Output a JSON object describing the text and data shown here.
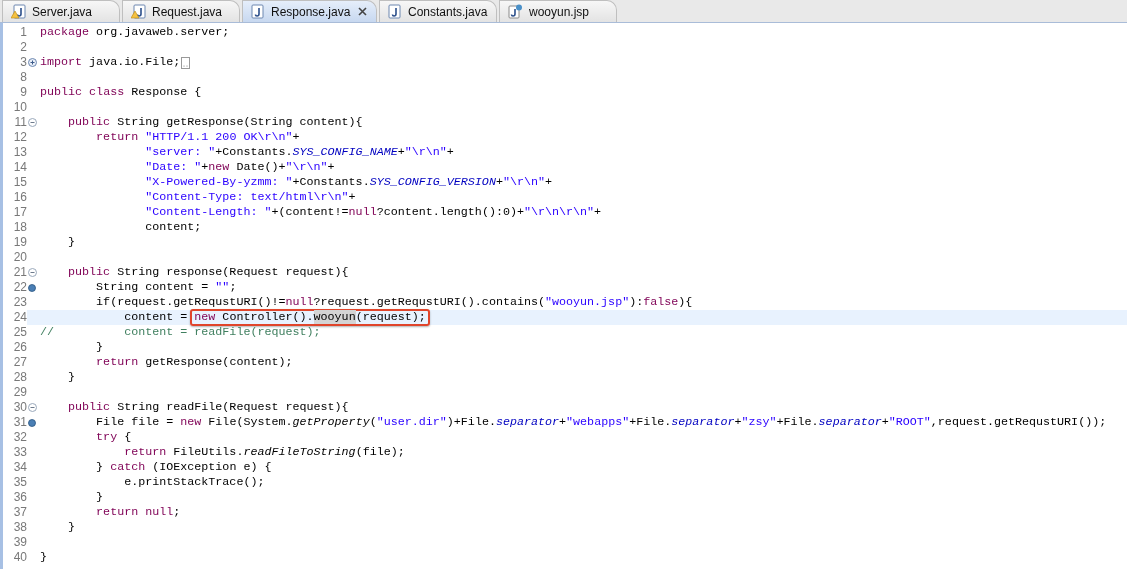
{
  "tabs": [
    {
      "label": "Server.java",
      "kind": "java-warning",
      "selected": false,
      "closable": false
    },
    {
      "label": "Request.java",
      "kind": "java-warning",
      "selected": false,
      "closable": false
    },
    {
      "label": "Response.java",
      "kind": "java",
      "selected": true,
      "closable": true
    },
    {
      "label": "Constants.java",
      "kind": "java",
      "selected": false,
      "closable": false
    },
    {
      "label": "wooyun.jsp",
      "kind": "jsp",
      "selected": false,
      "closable": false
    }
  ],
  "lines": [
    {
      "number": "1",
      "kind": "plain",
      "tokens": [
        {
          "kind": "keyword",
          "text": "package"
        },
        {
          "kind": "plain",
          "text": " org.javaweb.server;"
        }
      ]
    },
    {
      "number": "2",
      "kind": "plain"
    },
    {
      "number": "3",
      "kind": "expand",
      "folded": true,
      "tokens": [
        {
          "kind": "keyword",
          "text": "import"
        },
        {
          "kind": "plain",
          "text": " java.io.File;"
        }
      ]
    },
    {
      "number": "8",
      "kind": "plain"
    },
    {
      "number": "9",
      "kind": "plain",
      "tokens": [
        {
          "kind": "keyword",
          "text": "public "
        },
        {
          "kind": "keyword",
          "text": "class"
        },
        {
          "kind": "plain",
          "text": " Response {"
        }
      ]
    },
    {
      "number": "10",
      "kind": "plain"
    },
    {
      "number": "11",
      "kind": "collapse",
      "tokens": [
        {
          "kind": "keyword",
          "text": "    public"
        },
        {
          "kind": "plain",
          "text": " String getResponse(String content){"
        }
      ]
    },
    {
      "number": "12",
      "kind": "plain",
      "tokens": [
        {
          "kind": "keyword",
          "text": "        return"
        },
        {
          "kind": "string",
          "text": " \"HTTP/1.1 200 OK\\r\\n\""
        },
        {
          "kind": "plain",
          "text": "+"
        }
      ]
    },
    {
      "number": "13",
      "kind": "plain",
      "tokens": [
        {
          "kind": "string",
          "text": "               \"server: \""
        },
        {
          "kind": "plain",
          "text": "+Constants."
        },
        {
          "kind": "field",
          "text": "SYS_CONFIG_NAME"
        },
        {
          "kind": "plain",
          "text": "+"
        },
        {
          "kind": "string",
          "text": "\"\\r\\n\""
        },
        {
          "kind": "plain",
          "text": "+"
        }
      ]
    },
    {
      "number": "14",
      "kind": "plain",
      "tokens": [
        {
          "kind": "string",
          "text": "               \"Date: \""
        },
        {
          "kind": "plain",
          "text": "+"
        },
        {
          "kind": "keyword",
          "text": "new"
        },
        {
          "kind": "plain",
          "text": " Date()+"
        },
        {
          "kind": "string",
          "text": "\"\\r\\n\""
        },
        {
          "kind": "plain",
          "text": "+"
        }
      ]
    },
    {
      "number": "15",
      "kind": "plain",
      "tokens": [
        {
          "kind": "string",
          "text": "               \"X-Powered-By-yzmm: \""
        },
        {
          "kind": "plain",
          "text": "+Constants."
        },
        {
          "kind": "field",
          "text": "SYS_CONFIG_VERSION"
        },
        {
          "kind": "plain",
          "text": "+"
        },
        {
          "kind": "string",
          "text": "\"\\r\\n\""
        },
        {
          "kind": "plain",
          "text": "+"
        }
      ]
    },
    {
      "number": "16",
      "kind": "plain",
      "tokens": [
        {
          "kind": "string",
          "text": "               \"Content-Type: text/html\\r\\n\""
        },
        {
          "kind": "plain",
          "text": "+"
        }
      ]
    },
    {
      "number": "17",
      "kind": "plain",
      "tokens": [
        {
          "kind": "string",
          "text": "               \"Content-Length: \""
        },
        {
          "kind": "plain",
          "text": "+(content!="
        },
        {
          "kind": "keyword",
          "text": "null"
        },
        {
          "kind": "plain",
          "text": "?content.length():0)+"
        },
        {
          "kind": "string",
          "text": "\"\\r\\n\\r\\n\""
        },
        {
          "kind": "plain",
          "text": "+"
        }
      ]
    },
    {
      "number": "18",
      "kind": "plain",
      "tokens": [
        {
          "kind": "plain",
          "text": "               content;"
        }
      ]
    },
    {
      "number": "19",
      "kind": "plain",
      "tokens": [
        {
          "kind": "plain",
          "text": "    }"
        }
      ]
    },
    {
      "number": "20",
      "kind": "plain"
    },
    {
      "number": "21",
      "kind": "collapse",
      "tokens": [
        {
          "kind": "keyword",
          "text": "    public"
        },
        {
          "kind": "plain",
          "text": " String response(Request request){"
        }
      ]
    },
    {
      "number": "22",
      "kind": "override",
      "tokens": [
        {
          "kind": "plain",
          "text": "        String content = "
        },
        {
          "kind": "string",
          "text": "\"\""
        },
        {
          "kind": "plain",
          "text": ";"
        }
      ]
    },
    {
      "number": "23",
      "kind": "plain",
      "tokens": [
        {
          "kind": "plain",
          "text": "        if(request.getRequstURI()!="
        },
        {
          "kind": "keyword",
          "text": "null"
        },
        {
          "kind": "plain",
          "text": "?request.getRequstURI().contains("
        },
        {
          "kind": "string",
          "text": "\"wooyun.jsp\""
        },
        {
          "kind": "plain",
          "text": "):"
        },
        {
          "kind": "keyword",
          "text": "false"
        },
        {
          "kind": "plain",
          "text": "){"
        }
      ]
    },
    {
      "number": "24",
      "kind": "plain",
      "current": true,
      "tokens": [
        {
          "kind": "plain",
          "text": "            content = "
        },
        {
          "kind": "callout",
          "children": [
            {
              "kind": "keyword",
              "text": "new"
            },
            {
              "kind": "plain",
              "text": " Controller()."
            },
            {
              "kind": "occurrence",
              "text": "wooyun"
            },
            {
              "kind": "plain",
              "text": "(request);"
            }
          ]
        }
      ]
    },
    {
      "number": "25",
      "kind": "plain",
      "tokens": [
        {
          "kind": "comment",
          "text": "//          content = readFile(request);"
        }
      ]
    },
    {
      "number": "26",
      "kind": "plain",
      "tokens": [
        {
          "kind": "plain",
          "text": "        }"
        }
      ]
    },
    {
      "number": "27",
      "kind": "plain",
      "tokens": [
        {
          "kind": "keyword",
          "text": "        return"
        },
        {
          "kind": "plain",
          "text": " getResponse(content);"
        }
      ]
    },
    {
      "number": "28",
      "kind": "plain",
      "tokens": [
        {
          "kind": "plain",
          "text": "    }"
        }
      ]
    },
    {
      "number": "29",
      "kind": "plain"
    },
    {
      "number": "30",
      "kind": "collapse",
      "tokens": [
        {
          "kind": "keyword",
          "text": "    public"
        },
        {
          "kind": "plain",
          "text": " String readFile(Request request){"
        }
      ]
    },
    {
      "number": "31",
      "kind": "override",
      "tokens": [
        {
          "kind": "plain",
          "text": "        File file = "
        },
        {
          "kind": "keyword",
          "text": "new"
        },
        {
          "kind": "plain",
          "text": " File(System."
        },
        {
          "kind": "static-method",
          "text": "getProperty"
        },
        {
          "kind": "plain",
          "text": "("
        },
        {
          "kind": "string",
          "text": "\"user.dir\""
        },
        {
          "kind": "plain",
          "text": ")+File."
        },
        {
          "kind": "field",
          "text": "separator"
        },
        {
          "kind": "plain",
          "text": "+"
        },
        {
          "kind": "string",
          "text": "\"webapps\""
        },
        {
          "kind": "plain",
          "text": "+File."
        },
        {
          "kind": "field",
          "text": "separator"
        },
        {
          "kind": "plain",
          "text": "+"
        },
        {
          "kind": "string",
          "text": "\"zsy\""
        },
        {
          "kind": "plain",
          "text": "+File."
        },
        {
          "kind": "field",
          "text": "separator"
        },
        {
          "kind": "plain",
          "text": "+"
        },
        {
          "kind": "string",
          "text": "\"ROOT\""
        },
        {
          "kind": "plain",
          "text": ",request.getRequstURI());"
        }
      ]
    },
    {
      "number": "32",
      "kind": "plain",
      "tokens": [
        {
          "kind": "keyword",
          "text": "        try"
        },
        {
          "kind": "plain",
          "text": " {"
        }
      ]
    },
    {
      "number": "33",
      "kind": "plain",
      "tokens": [
        {
          "kind": "keyword",
          "text": "            return"
        },
        {
          "kind": "plain",
          "text": " FileUtils."
        },
        {
          "kind": "static-method",
          "text": "readFileToString"
        },
        {
          "kind": "plain",
          "text": "(file);"
        }
      ]
    },
    {
      "number": "34",
      "kind": "plain",
      "tokens": [
        {
          "kind": "plain",
          "text": "        } "
        },
        {
          "kind": "keyword",
          "text": "catch"
        },
        {
          "kind": "plain",
          "text": " (IOException e) {"
        }
      ]
    },
    {
      "number": "35",
      "kind": "plain",
      "tokens": [
        {
          "kind": "plain",
          "text": "            e.printStackTrace();"
        }
      ]
    },
    {
      "number": "36",
      "kind": "plain",
      "tokens": [
        {
          "kind": "plain",
          "text": "        }"
        }
      ]
    },
    {
      "number": "37",
      "kind": "plain",
      "tokens": [
        {
          "kind": "keyword",
          "text": "        return"
        },
        {
          "kind": "keyword",
          "text": " null"
        },
        {
          "kind": "plain",
          "text": ";"
        }
      ]
    },
    {
      "number": "38",
      "kind": "plain",
      "tokens": [
        {
          "kind": "plain",
          "text": "    }"
        }
      ]
    },
    {
      "number": "39",
      "kind": "plain"
    },
    {
      "number": "40",
      "kind": "plain",
      "tokens": [
        {
          "kind": "plain",
          "text": "}"
        }
      ]
    }
  ]
}
